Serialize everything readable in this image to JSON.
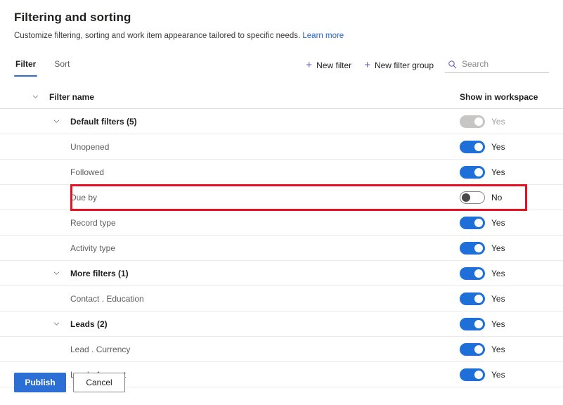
{
  "header": {
    "title": "Filtering and sorting",
    "subtitle": "Customize filtering, sorting and work item appearance tailored to specific needs.",
    "learn_more": "Learn more"
  },
  "tabs": [
    {
      "label": "Filter",
      "active": true
    },
    {
      "label": "Sort",
      "active": false
    }
  ],
  "toolbar": {
    "new_filter": "New filter",
    "new_filter_group": "New filter group",
    "search_placeholder": "Search",
    "search_value": ""
  },
  "table": {
    "columns": {
      "name": "Filter name",
      "toggle": "Show in workspace"
    },
    "rows": [
      {
        "label": "Default filters (5)",
        "level": "group",
        "chevron": true,
        "toggle_state": "disabled",
        "toggle_label": "Yes",
        "highlighted": false
      },
      {
        "label": "Unopened",
        "level": "child",
        "chevron": false,
        "toggle_state": "on",
        "toggle_label": "Yes",
        "highlighted": false
      },
      {
        "label": "Followed",
        "level": "child",
        "chevron": false,
        "toggle_state": "on",
        "toggle_label": "Yes",
        "highlighted": false
      },
      {
        "label": "Due by",
        "level": "child",
        "chevron": false,
        "toggle_state": "off",
        "toggle_label": "No",
        "highlighted": true
      },
      {
        "label": "Record type",
        "level": "child",
        "chevron": false,
        "toggle_state": "on",
        "toggle_label": "Yes",
        "highlighted": false
      },
      {
        "label": "Activity type",
        "level": "child",
        "chevron": false,
        "toggle_state": "on",
        "toggle_label": "Yes",
        "highlighted": false
      },
      {
        "label": "More filters (1)",
        "level": "group",
        "chevron": true,
        "toggle_state": "on",
        "toggle_label": "Yes",
        "highlighted": false
      },
      {
        "label": "Contact . Education",
        "level": "child",
        "chevron": false,
        "toggle_state": "on",
        "toggle_label": "Yes",
        "highlighted": false
      },
      {
        "label": "Leads (2)",
        "level": "group",
        "chevron": true,
        "toggle_state": "on",
        "toggle_label": "Yes",
        "highlighted": false
      },
      {
        "label": "Lead . Currency",
        "level": "child",
        "chevron": false,
        "toggle_state": "on",
        "toggle_label": "Yes",
        "highlighted": false
      },
      {
        "label": "Lead . Account",
        "level": "child",
        "chevron": false,
        "toggle_state": "on",
        "toggle_label": "Yes",
        "highlighted": false
      }
    ]
  },
  "footer": {
    "publish": "Publish",
    "cancel": "Cancel"
  },
  "colors": {
    "accent_blue": "#2b6fd4",
    "toggle_on": "#1f6fd9",
    "link_blue": "#2266cc",
    "icon_purple": "#5b5fc7",
    "highlight_red": "#e81123",
    "toggle_disabled": "#c8c6c4"
  }
}
